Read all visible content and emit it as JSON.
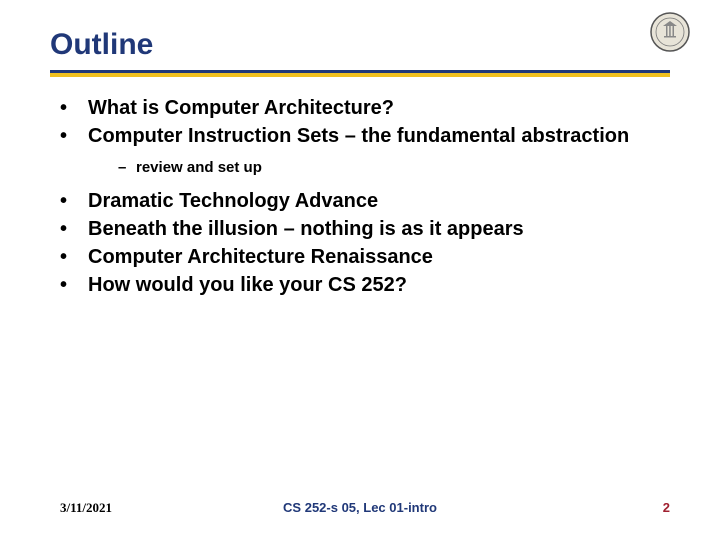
{
  "header": {
    "title": "Outline"
  },
  "bullets": {
    "b0": "What is Computer Architecture?",
    "b1": "Computer Instruction Sets – the fundamental abstraction",
    "b1_sub0": "review and set up",
    "b2": "Dramatic Technology Advance",
    "b3": "Beneath the illusion – nothing is as it appears",
    "b4": "Computer Architecture Renaissance",
    "b5": "How would you like your CS 252?"
  },
  "footer": {
    "date": "3/11/2021",
    "center": "CS 252-s 05, Lec 01-intro",
    "page": "2"
  }
}
